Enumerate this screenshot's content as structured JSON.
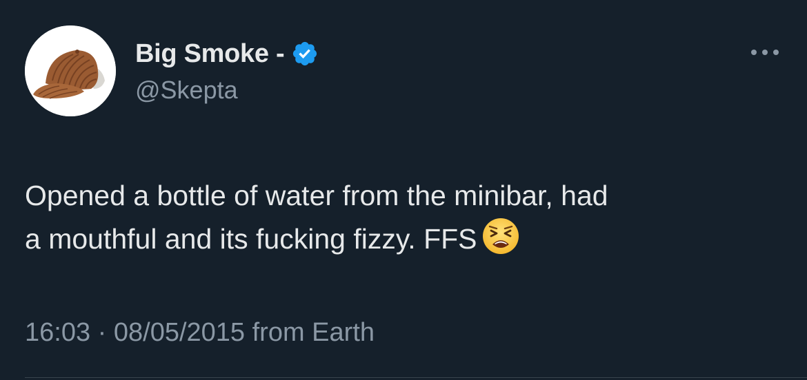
{
  "tweet": {
    "author": {
      "display_name": "Big Smoke -",
      "handle": "@Skepta",
      "verified": true,
      "avatar_icon": "corduroy-cap-avatar"
    },
    "text_line1": "Opened a bottle of water from the minibar, had",
    "text_line2": "a mouthful and its fucking fizzy. FFS",
    "emoji_icon": "tired-face-emoji",
    "time": "16:03",
    "separator": "·",
    "date": "08/05/2015",
    "source": "from Earth",
    "more_icon": "more-options-icon"
  },
  "colors": {
    "background": "#15202b",
    "text": "#e7e9ea",
    "secondary_text": "#8b98a5",
    "verified_badge": "#1d9bf0",
    "divider": "#38444d"
  }
}
